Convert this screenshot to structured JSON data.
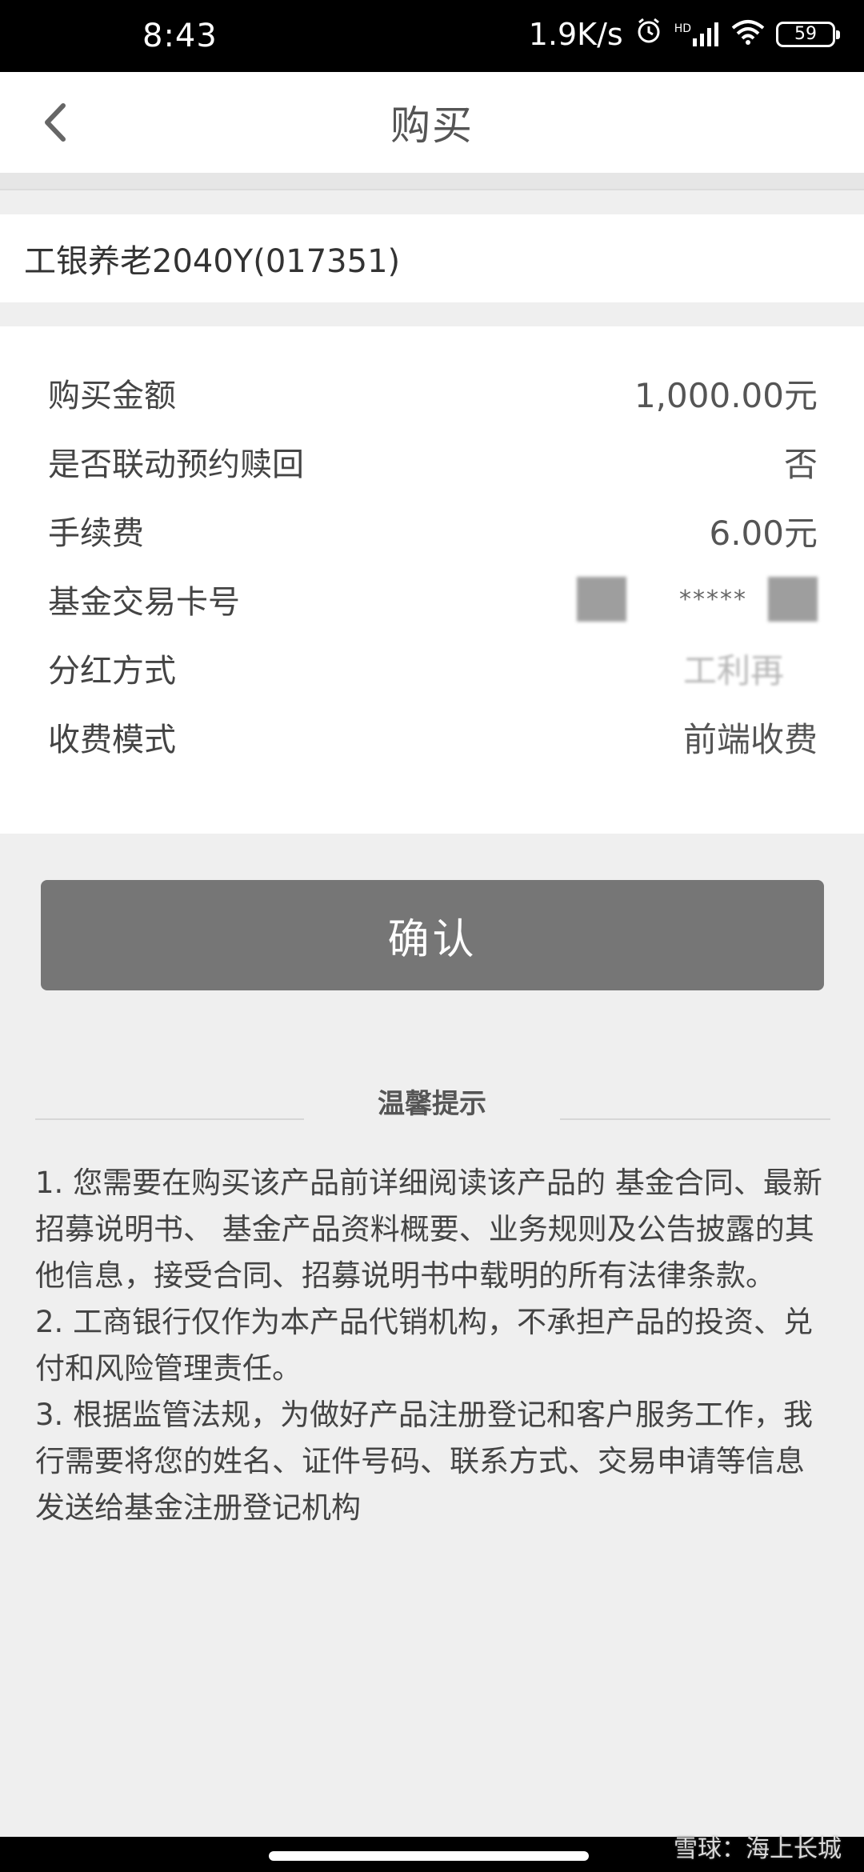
{
  "status_bar": {
    "time": "8:43",
    "net_speed": "1.9K/s",
    "signal_label": "HD",
    "battery": "59"
  },
  "header": {
    "title": "购买"
  },
  "product": {
    "name": "工银养老2040Y(017351)"
  },
  "details": [
    {
      "label": "购买金额",
      "value": "1,000.00元"
    },
    {
      "label": "是否联动预约赎回",
      "value": "否"
    },
    {
      "label": "手续费",
      "value": "6.00元"
    },
    {
      "label": "基金交易卡号",
      "value": "*****"
    },
    {
      "label": "分红方式",
      "value": "工利再"
    },
    {
      "label": "收费模式",
      "value": "前端收费"
    }
  ],
  "confirm_button": "确认",
  "tips": {
    "title": "温馨提示",
    "items": [
      "1. 您需要在购买该产品前详细阅读该产品的 基金合同、最新招募说明书、 基金产品资料概要、业务规则及公告披露的其他信息，接受合同、招募说明书中载明的所有法律条款。",
      "2. 工商银行仅作为本产品代销机构，不承担产品的投资、兑付和风险管理责任。",
      "3. 根据监管法规，为做好产品注册登记和客户服务工作，我行需要将您的姓名、证件号码、联系方式、交易申请等信息发送给基金注册登记机构"
    ]
  },
  "watermark": "雪球：海上长城"
}
